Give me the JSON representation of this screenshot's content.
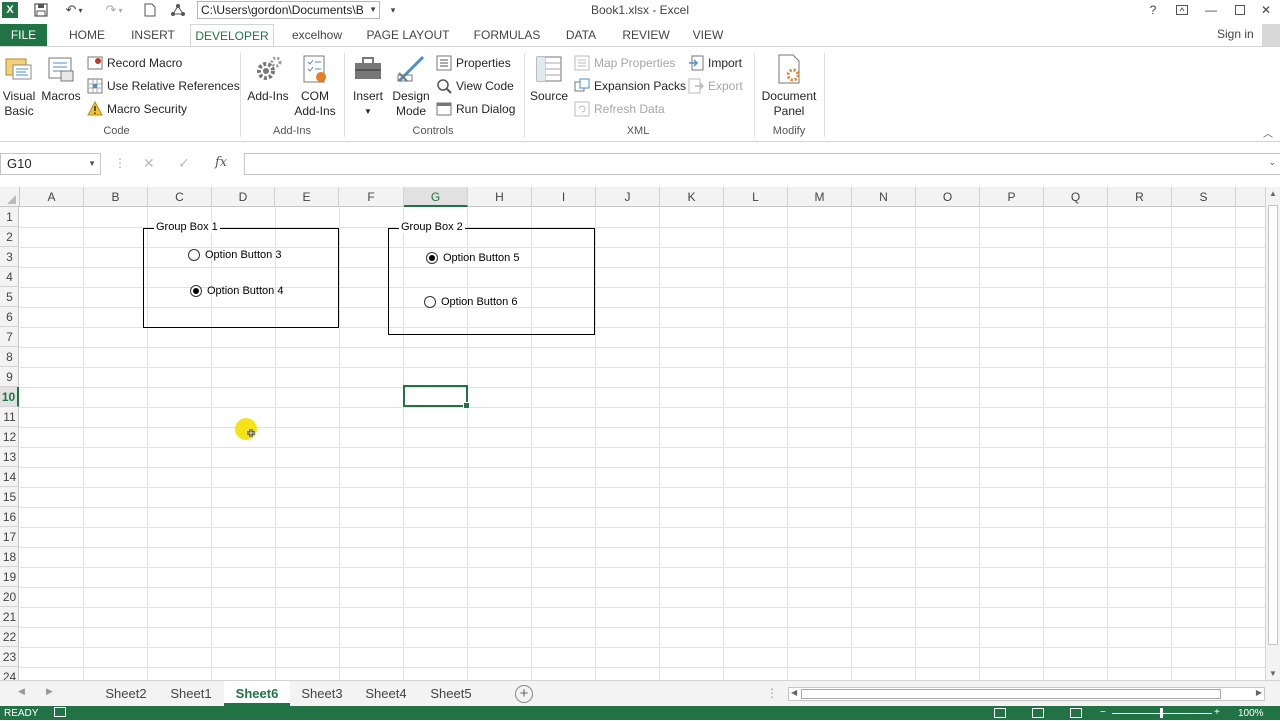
{
  "titlebar": {
    "path": "C:\\Users\\gordon\\Documents\\B",
    "title": "Book1.xlsx - Excel",
    "help": "?",
    "logo": "X"
  },
  "tabs": [
    "FILE",
    "HOME",
    "INSERT",
    "DEVELOPER",
    "excelhow",
    "PAGE LAYOUT",
    "FORMULAS",
    "DATA",
    "REVIEW",
    "VIEW"
  ],
  "active_tab": "DEVELOPER",
  "signin": "Sign in",
  "ribbon": {
    "code": {
      "label": "Code",
      "visual_basic": [
        "Visual",
        "Basic"
      ],
      "macros": "Macros",
      "record_macro": "Record Macro",
      "use_relative": "Use Relative References",
      "macro_security": "Macro Security"
    },
    "addins": {
      "label": "Add-Ins",
      "addins": "Add-Ins",
      "com": [
        "COM",
        "Add-Ins"
      ]
    },
    "controls": {
      "label": "Controls",
      "insert": "Insert",
      "design_mode": [
        "Design",
        "Mode"
      ],
      "properties": "Properties",
      "view_code": "View Code",
      "run_dialog": "Run Dialog"
    },
    "xml": {
      "label": "XML",
      "source": "Source",
      "map_properties": "Map Properties",
      "expansion_packs": "Expansion Packs",
      "refresh_data": "Refresh Data",
      "import": "Import",
      "export": "Export"
    },
    "modify": {
      "label": "Modify",
      "document_panel": [
        "Document",
        "Panel"
      ]
    }
  },
  "formula_bar": {
    "name_box": "G10",
    "fx": "fx",
    "value": ""
  },
  "columns": [
    "A",
    "B",
    "C",
    "D",
    "E",
    "F",
    "G",
    "H",
    "I",
    "J",
    "K",
    "L",
    "M",
    "N",
    "O",
    "P",
    "Q",
    "R",
    "S"
  ],
  "rows": [
    "1",
    "2",
    "3",
    "4",
    "5",
    "6",
    "7",
    "8",
    "9",
    "10",
    "11",
    "12",
    "13",
    "14",
    "15",
    "16",
    "17",
    "18",
    "19",
    "20",
    "21",
    "22",
    "23",
    "24"
  ],
  "selected_column": "G",
  "selected_row": "10",
  "group_boxes": [
    {
      "label": "Group Box 1",
      "options": [
        {
          "label": "Option Button 3",
          "checked": false
        },
        {
          "label": "Option Button 4",
          "checked": true
        }
      ]
    },
    {
      "label": "Group Box 2",
      "options": [
        {
          "label": "Option Button 5",
          "checked": true
        },
        {
          "label": "Option Button 6",
          "checked": false
        }
      ]
    }
  ],
  "sheets": [
    "Sheet2",
    "Sheet1",
    "Sheet6",
    "Sheet3",
    "Sheet4",
    "Sheet5"
  ],
  "active_sheet": "Sheet6",
  "status": {
    "ready": "READY",
    "zoom": "100%"
  },
  "colors": {
    "excel_green": "#217346"
  }
}
